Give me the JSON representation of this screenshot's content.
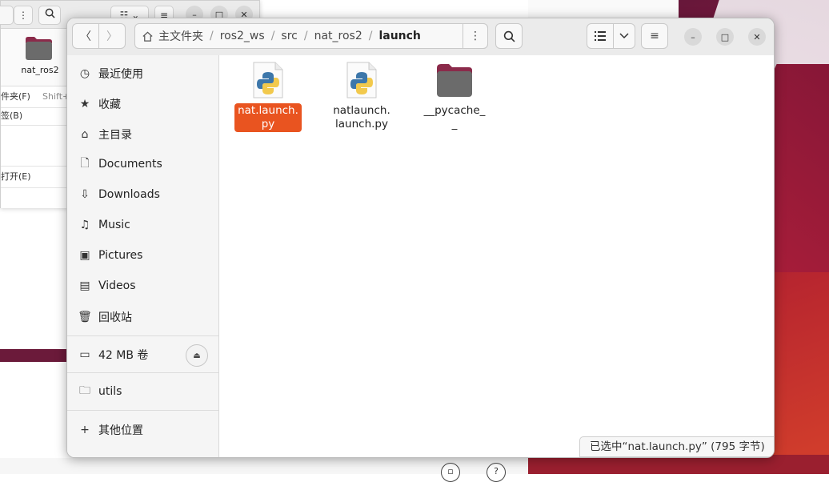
{
  "background_window": {
    "folder_label": "nat_ros2",
    "menu": [
      {
        "label": "件夹(F)",
        "accel": "Shift+"
      },
      {
        "label": "签(B)",
        "accel": ""
      },
      {
        "label": "",
        "accel": ""
      },
      {
        "label": "打开(E)",
        "accel": ""
      }
    ]
  },
  "header": {
    "back_label": "〈",
    "forward_label": "〉",
    "breadcrumb": [
      "主文件夹",
      "ros2_ws",
      "src",
      "nat_ros2",
      "launch"
    ],
    "separator": "/"
  },
  "sidebar": {
    "places": [
      {
        "label": "最近使用",
        "icon": "clock-icon"
      },
      {
        "label": "收藏",
        "icon": "star-icon"
      },
      {
        "label": "主目录",
        "icon": "home-icon"
      },
      {
        "label": "Documents",
        "icon": "document-icon"
      },
      {
        "label": "Downloads",
        "icon": "download-icon"
      },
      {
        "label": "Music",
        "icon": "music-icon"
      },
      {
        "label": "Pictures",
        "icon": "picture-icon"
      },
      {
        "label": "Videos",
        "icon": "video-icon"
      },
      {
        "label": "回收站",
        "icon": "trash-icon"
      }
    ],
    "volume": {
      "label": "42 MB 卷",
      "icon": "drive-icon"
    },
    "bookmark": {
      "label": "utils",
      "icon": "folder-icon"
    },
    "other": {
      "label": "其他位置",
      "icon": "plus-icon"
    }
  },
  "files": [
    {
      "name": "nat.launch.py",
      "display": "nat.launch.\npy",
      "type": "python",
      "selected": true
    },
    {
      "name": "natlaunch.launch.py",
      "display": "natlaunch.\nlaunch.py",
      "type": "python",
      "selected": false
    },
    {
      "name": "__pycache__",
      "display": "__pycache_\n_",
      "type": "folder",
      "selected": false
    }
  ],
  "status_bar": "已选中“nat.launch.py” (795 字节)",
  "colors": {
    "accent": "#e95420",
    "folder": "#6b6b6b",
    "folder_tab": "#8b2a4a"
  }
}
